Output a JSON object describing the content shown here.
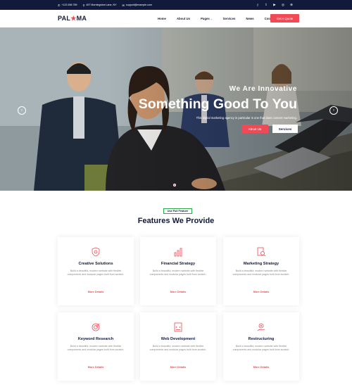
{
  "topbar": {
    "phone": "+123 456 789",
    "address": "457 Morningview Lane, NY",
    "email": "support@example.com",
    "socials": [
      "facebook-icon",
      "twitter-icon",
      "youtube-icon",
      "instagram-icon",
      "dribbble-icon"
    ]
  },
  "nav": {
    "logo_left": "PAL",
    "logo_star": "★",
    "logo_right": "MA",
    "items": [
      "Home",
      "About Us",
      "Pages",
      "Services",
      "News",
      "Contact Us"
    ],
    "cta": "Get A Quote"
  },
  "hero": {
    "eyebrow": "We Are Innovative",
    "title": "Something Good To You",
    "subtitle": "This digital marketing agency in particular is one that does content marketing.",
    "primary_button": "About Us",
    "secondary_button": "Services"
  },
  "features": {
    "badge": "Use Full Feature",
    "title": "Features We Provide",
    "cards": [
      {
        "title": "Creative Solutions",
        "desc": "Build a beautiful, modern website with flexible components and modular pages built from scratch.",
        "link": "More Details",
        "icon": "shield-icon"
      },
      {
        "title": "Financial Strategy",
        "desc": "Build a beautiful, modern website with flexible components and modular pages built from scratch.",
        "link": "More Details",
        "icon": "chart-icon"
      },
      {
        "title": "Marketing Strategy",
        "desc": "Build a beautiful, modern website with flexible components and modular pages built from scratch.",
        "link": "More Details",
        "icon": "search-doc-icon"
      },
      {
        "title": "Keyword Research",
        "desc": "Build a beautiful, modern website with flexible components and modular pages built from scratch.",
        "link": "More Details",
        "icon": "target-icon"
      },
      {
        "title": "Web Development",
        "desc": "Build a beautiful, modern website with flexible components and modular pages built from scratch.",
        "link": "More Details",
        "icon": "code-doc-icon"
      },
      {
        "title": "Restructuring",
        "desc": "Build a beautiful, modern website with flexible components and modular pages built from scratch.",
        "link": "More Details",
        "icon": "gear-hand-icon"
      }
    ]
  },
  "colors": {
    "accent": "#ef4a55",
    "navy": "#121a3b",
    "badge_border": "#2da84a"
  }
}
